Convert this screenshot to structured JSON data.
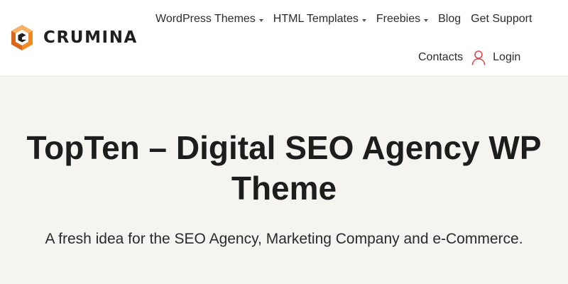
{
  "brand": {
    "name": "CRUMINA",
    "colors": {
      "orange": "#f08a24",
      "dark": "#1f1f1f",
      "accent_red": "#e0474c"
    }
  },
  "nav": {
    "items": [
      {
        "label": "WordPress Themes",
        "dropdown": true
      },
      {
        "label": "HTML Templates",
        "dropdown": true
      },
      {
        "label": "Freebies",
        "dropdown": true
      },
      {
        "label": "Blog",
        "dropdown": false
      },
      {
        "label": "Get Support",
        "dropdown": false
      }
    ],
    "contacts": "Contacts",
    "login": "Login",
    "login_icon": "user-icon"
  },
  "hero": {
    "title": "TopTen – Digital SEO Agency WP Theme",
    "subtitle": "A fresh idea for the SEO Agency, Marketing Company and e-Commerce."
  }
}
